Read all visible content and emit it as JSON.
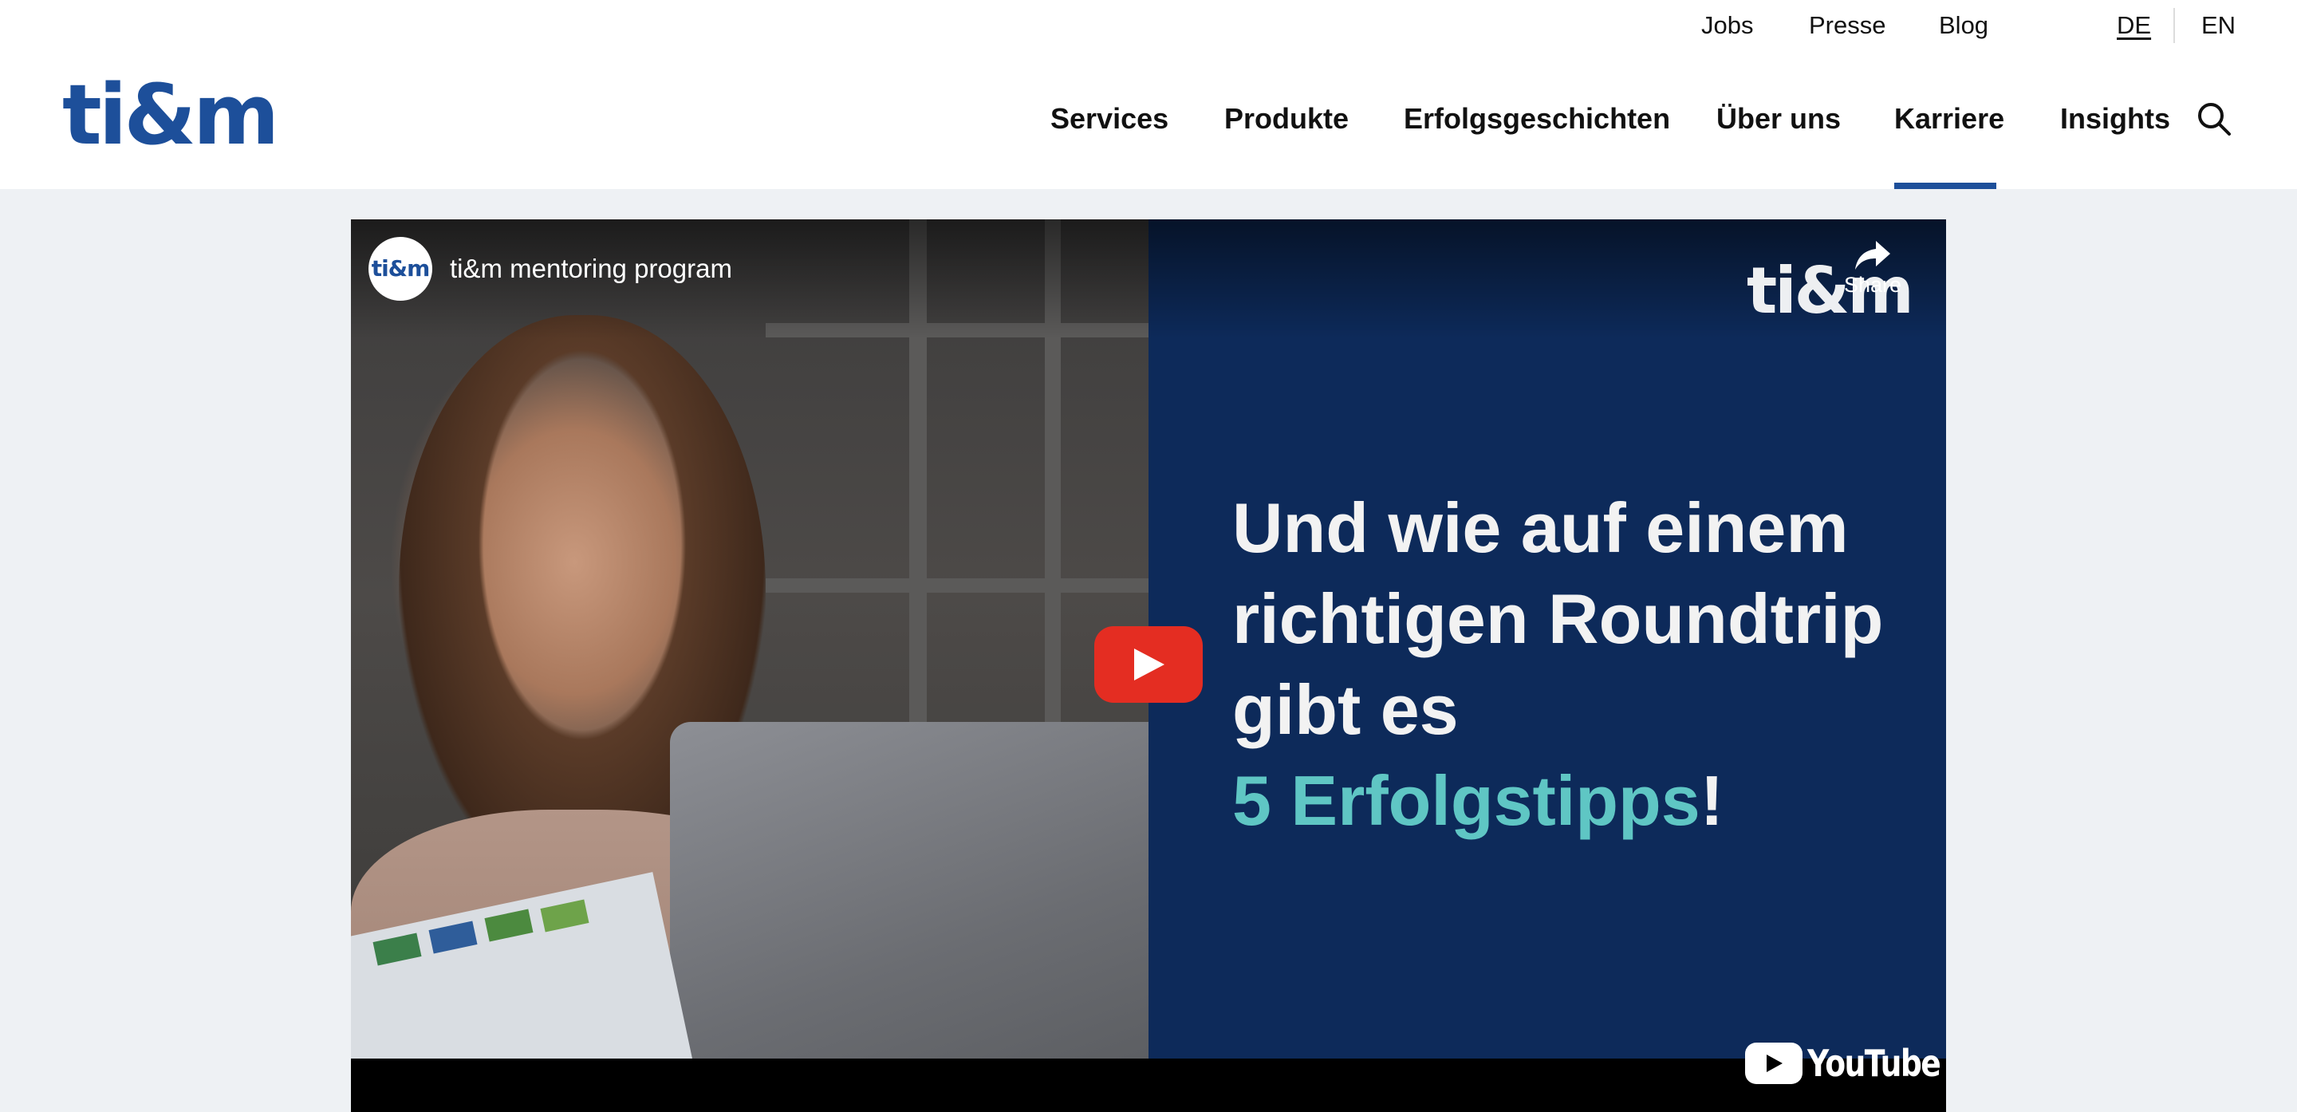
{
  "brand": {
    "logo_text": "ti&m",
    "color": "#1d4f9a"
  },
  "meta_nav": {
    "jobs": "Jobs",
    "presse": "Presse",
    "blog": "Blog",
    "lang_de": "DE",
    "lang_en": "EN",
    "active_language": "DE"
  },
  "main_nav": {
    "items": [
      {
        "label": "Services"
      },
      {
        "label": "Produkte"
      },
      {
        "label": "Erfolgsgeschichten"
      },
      {
        "label": "Über uns"
      },
      {
        "label": "Karriere"
      },
      {
        "label": "Insights"
      }
    ],
    "active_item": "Karriere",
    "search_icon": "search-icon"
  },
  "video": {
    "channel_avatar_text": "ti&m",
    "title": "ti&m mentoring program",
    "share_label": "Share",
    "watermark_logo": "ti&m",
    "overlay_lines": [
      "Und wie auf einem",
      "richtigen Roundtrip",
      "gibt es"
    ],
    "overlay_accent": "5 Erfolgstipps",
    "overlay_punct": "!",
    "platform_label": "YouTube",
    "panel_color": "#0d2a5a",
    "accent_color": "#5fc6c4",
    "play_button_color": "#e42d22"
  }
}
